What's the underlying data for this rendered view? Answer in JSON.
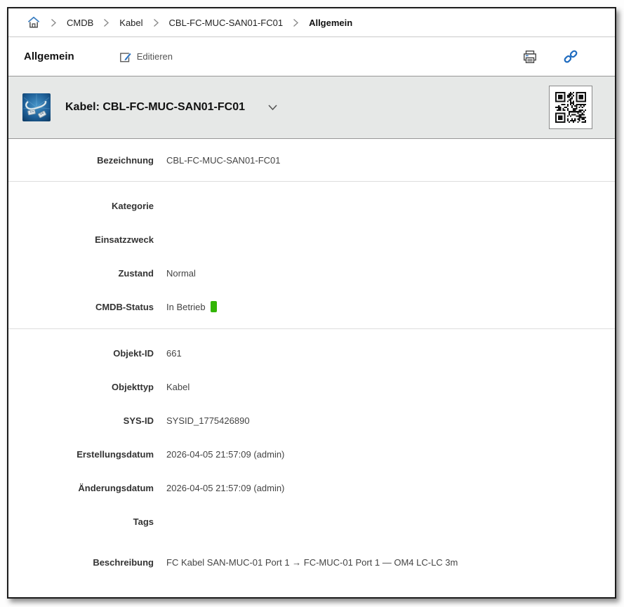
{
  "colors": {
    "accent_blue": "#2e74c0",
    "link_blue": "#1e6bbf",
    "status_green": "#33b505",
    "header_bg": "#e6e8e7"
  },
  "breadcrumb": {
    "home_icon": "home-icon",
    "items": [
      {
        "label": "CMDB"
      },
      {
        "label": "Kabel"
      },
      {
        "label": "CBL-FC-MUC-SAN01-FC01"
      },
      {
        "label": "Allgemein"
      }
    ]
  },
  "toolbar": {
    "title": "Allgemein",
    "edit_label": "Editieren",
    "edit_icon": "edit-icon",
    "print_icon": "print-icon",
    "link_icon": "link-icon"
  },
  "object_header": {
    "title": "Kabel: CBL-FC-MUC-SAN01-FC01",
    "object_icon": "cable-object-icon",
    "dropdown_icon": "chevron-down-icon",
    "qr_code": "qr-code"
  },
  "groups": [
    {
      "rows": [
        {
          "label": "Bezeichnung",
          "value": "CBL-FC-MUC-SAN01-FC01"
        }
      ]
    },
    {
      "rows": [
        {
          "label": "Kategorie",
          "value": ""
        },
        {
          "label": "Einsatzzweck",
          "value": ""
        },
        {
          "label": "Zustand",
          "value": "Normal"
        },
        {
          "label": "CMDB-Status",
          "value": "In Betrieb",
          "badge_color": "#33b505"
        }
      ]
    },
    {
      "rows": [
        {
          "label": "Objekt-ID",
          "value": "661"
        },
        {
          "label": "Objekttyp",
          "value": "Kabel"
        },
        {
          "label": "SYS-ID",
          "value": "SYSID_1775426890"
        },
        {
          "label": "Erstellungsdatum",
          "value": "2026-04-05 21:57:09 (admin)"
        },
        {
          "label": "Änderungsdatum",
          "value": "2026-04-05 21:57:09 (admin)"
        },
        {
          "label": "Tags",
          "value": ""
        },
        {
          "label": "Beschreibung",
          "value": "FC Kabel SAN-MUC-01 Port 1 → FC-MUC-01 Port 1 — OM4 LC-LC 3m",
          "spaced": true
        }
      ]
    }
  ]
}
